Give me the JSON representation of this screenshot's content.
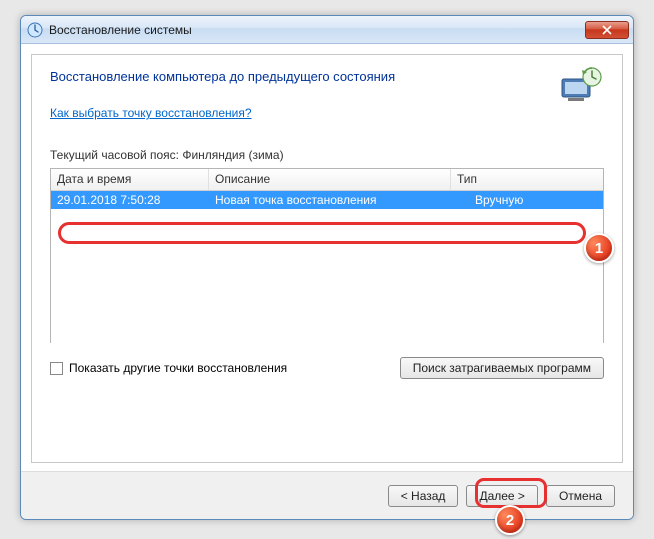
{
  "window": {
    "title": "Восстановление системы"
  },
  "main": {
    "heading": "Восстановление компьютера до предыдущего состояния",
    "help_link": "Как выбрать точку восстановления?",
    "timezone_label": "Текущий часовой пояс: Финляндия (зима)"
  },
  "table": {
    "columns": {
      "date": "Дата и время",
      "desc": "Описание",
      "type": "Тип"
    },
    "rows": [
      {
        "date": "29.01.2018 7:50:28",
        "desc": "Новая точка восстановления",
        "type": "Вручную"
      }
    ]
  },
  "controls": {
    "show_more_checkbox": "Показать другие точки восстановления",
    "scan_button": "Поиск затрагиваемых программ"
  },
  "footer": {
    "back": "< Назад",
    "next": "Далее >",
    "cancel": "Отмена"
  },
  "annotations": {
    "badge1": "1",
    "badge2": "2"
  }
}
